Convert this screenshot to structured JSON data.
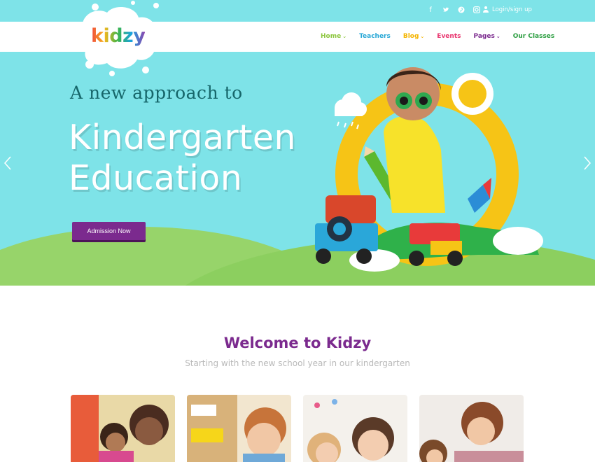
{
  "brand": {
    "logo_text": "kidzy",
    "logo_colors": [
      "#f0483e",
      "#f8b71c",
      "#3bb54a",
      "#1aa3e0",
      "#8e44ad"
    ]
  },
  "topbar": {
    "background": "#7ee3e8",
    "social_icons": [
      "facebook-icon",
      "twitter-icon",
      "pinterest-icon",
      "instagram-icon"
    ],
    "login_label": "Login/sign up"
  },
  "nav": {
    "items": [
      {
        "label": "Home",
        "color": "#8dc63f",
        "has_dropdown": true
      },
      {
        "label": "Teachers",
        "color": "#27a7d6",
        "has_dropdown": false
      },
      {
        "label": "Blog",
        "color": "#f4b400",
        "has_dropdown": true
      },
      {
        "label": "Events",
        "color": "#e8336d",
        "has_dropdown": false
      },
      {
        "label": "Pages",
        "color": "#7b2a8e",
        "has_dropdown": true
      },
      {
        "label": "Our Classes",
        "color": "#2a9d3f",
        "has_dropdown": false
      }
    ]
  },
  "hero": {
    "subtitle": "A new approach to",
    "title_line1": "Kindergarten",
    "title_line2": "Education",
    "cta_label": "Admission Now",
    "cta_color": "#7b2a8e"
  },
  "welcome": {
    "title": "Welcome to Kidzy",
    "subtitle": "Starting with the new school year in our kindergarten"
  }
}
